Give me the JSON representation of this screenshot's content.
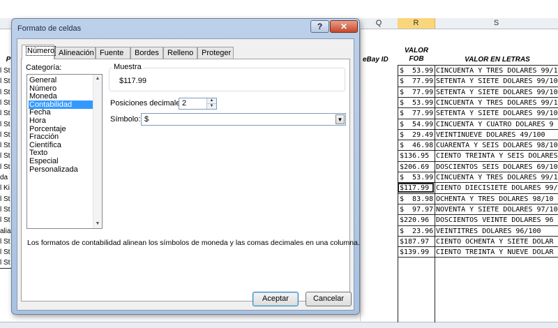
{
  "spreadsheet": {
    "columns": [
      {
        "label": "Q"
      },
      {
        "label": "R"
      },
      {
        "label": "S"
      }
    ],
    "header_cells": {
      "p_partial": "P",
      "ebay_id": "eBay ID",
      "valor_fob": "VALOR\nFOB",
      "valor_en_letras": "VALOR EN LETRAS"
    },
    "left_fragments": [
      "l St",
      "l St",
      "l St",
      "l St",
      "l St",
      "l St",
      "l St",
      "l St",
      "l St",
      "l St",
      "da",
      "l Ki",
      "l St",
      "l St",
      "l St",
      "alia",
      "l St",
      "l St",
      "l St"
    ],
    "rows": [
      {
        "fob": "$  53.99",
        "letras": "CINCUENTA Y TRES DOLARES 99/1"
      },
      {
        "fob": "$  77.99",
        "letras": "SETENTA Y SIETE DOLARES 99/10"
      },
      {
        "fob": "$  77.99",
        "letras": "SETENTA Y SIETE DOLARES 99/10"
      },
      {
        "fob": "$  53.99",
        "letras": "CINCUENTA Y TRES DOLARES 99/1"
      },
      {
        "fob": "$  77.99",
        "letras": "SETENTA Y SIETE DOLARES 99/10"
      },
      {
        "fob": "$  54.99",
        "letras": "CINCUENTA Y CUATRO DOLARES 9"
      },
      {
        "fob": "$  29.49",
        "letras": "VEINTINUEVE DOLARES 49/100"
      },
      {
        "fob": "$  46.98",
        "letras": "CUARENTA Y SEIS DOLARES 98/10"
      },
      {
        "fob": "$136.95",
        "letras": "CIENTO TREINTA Y SEIS DOLARES"
      },
      {
        "fob": "$206.69",
        "letras": "DOSCIENTOS SEIS DOLARES 69/10"
      },
      {
        "fob": "$  53.99",
        "letras": "CINCUENTA Y TRES DOLARES 99/1"
      },
      {
        "fob": "$117.99",
        "letras": "CIENTO DIECISIETE DOLARES 99/1"
      },
      {
        "fob": "$  83.98",
        "letras": "OCHENTA Y TRES DOLARES 98/10"
      },
      {
        "fob": "$  97.97",
        "letras": "NOVENTA Y SIETE DOLARES 97/10"
      },
      {
        "fob": "$220.96",
        "letras": "DOSCIENTOS VEINTE DOLARES 96"
      },
      {
        "fob": "$  23.96",
        "letras": "VEINTITRES DOLARES 96/100"
      },
      {
        "fob": "$187.97",
        "letras": "CIENTO OCHENTA Y SIETE DOLAR"
      },
      {
        "fob": "$139.99",
        "letras": "CIENTO TREINTA Y NUEVE DOLAR"
      }
    ],
    "selected_column": "R",
    "active_row_index": 11
  },
  "dialog": {
    "title": "Formato de celdas",
    "tabs": [
      {
        "label": "Número",
        "active": true
      },
      {
        "label": "Alineación"
      },
      {
        "label": "Fuente"
      },
      {
        "label": "Bordes"
      },
      {
        "label": "Relleno"
      },
      {
        "label": "Proteger"
      }
    ],
    "category_label": "Categoría:",
    "categories": [
      "General",
      "Número",
      "Moneda",
      "Contabilidad",
      "Fecha",
      "Hora",
      "Porcentaje",
      "Fracción",
      "Científica",
      "Texto",
      "Especial",
      "Personalizada"
    ],
    "selected_category": "Contabilidad",
    "sample_label": "Muestra",
    "sample_value": "$117.99",
    "decimals_label": "Posiciones decimales:",
    "decimals_value": "2",
    "symbol_label": "Símbolo:",
    "symbol_value": "$",
    "description": "Los formatos de contabilidad alinean los símbolos de moneda y las comas decimales en una columna.",
    "ok_label": "Aceptar",
    "cancel_label": "Cancelar",
    "help_glyph": "?",
    "close_glyph": "✕"
  }
}
